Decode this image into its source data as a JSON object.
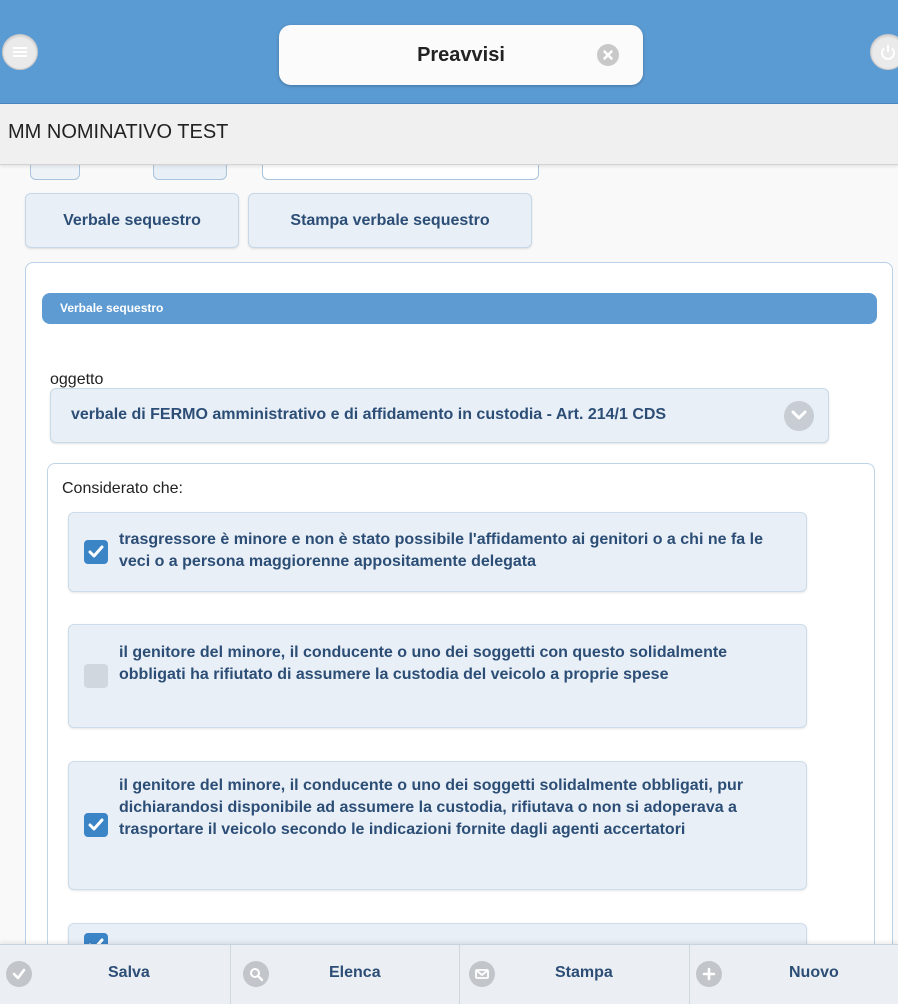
{
  "header": {
    "title": "Preavvisi",
    "menu_icon": "menu-icon",
    "clear_icon": "clear-icon",
    "power_icon": "power-icon"
  },
  "user_bar": {
    "name": "MM NOMINATIVO TEST"
  },
  "tabs": [
    {
      "label": "Verbale sequestro"
    },
    {
      "label": "Stampa verbale sequestro"
    }
  ],
  "panel": {
    "header": "Verbale sequestro",
    "oggetto_label": "oggetto",
    "oggetto_value": "verbale di FERMO amministrativo e di affidamento in custodia - Art. 214/1 CDS",
    "considerato_label": "Considerato che:",
    "conditions": [
      {
        "text": "trasgressore è minore e non è stato possibile l'affidamento ai genitori o a chi ne fa le veci o a persona maggiorenne appositamente delegata",
        "checked": true
      },
      {
        "text": "il genitore del minore, il conducente o uno dei soggetti con questo solidalmente obbligati ha rifiutato di assumere la custodia del veicolo a proprie spese",
        "checked": false
      },
      {
        "text": "il genitore del minore, il conducente o uno dei soggetti solidalmente obbligati, pur dichiarandosi disponibile ad assumere la custodia, rifiutava o non si adoperava a trasportare il veicolo secondo le indicazioni fornite dagli agenti accertatori",
        "checked": true
      },
      {
        "text": "",
        "checked": true
      }
    ]
  },
  "footer": [
    {
      "label": "Salva",
      "icon": "check-icon"
    },
    {
      "label": "Elenca",
      "icon": "search-icon"
    },
    {
      "label": "Stampa",
      "icon": "mail-icon"
    },
    {
      "label": "Nuovo",
      "icon": "plus-icon"
    }
  ],
  "colors": {
    "header_bg": "#5b9bd3",
    "accent": "#3b85c7",
    "button_text": "#2c4e76"
  }
}
